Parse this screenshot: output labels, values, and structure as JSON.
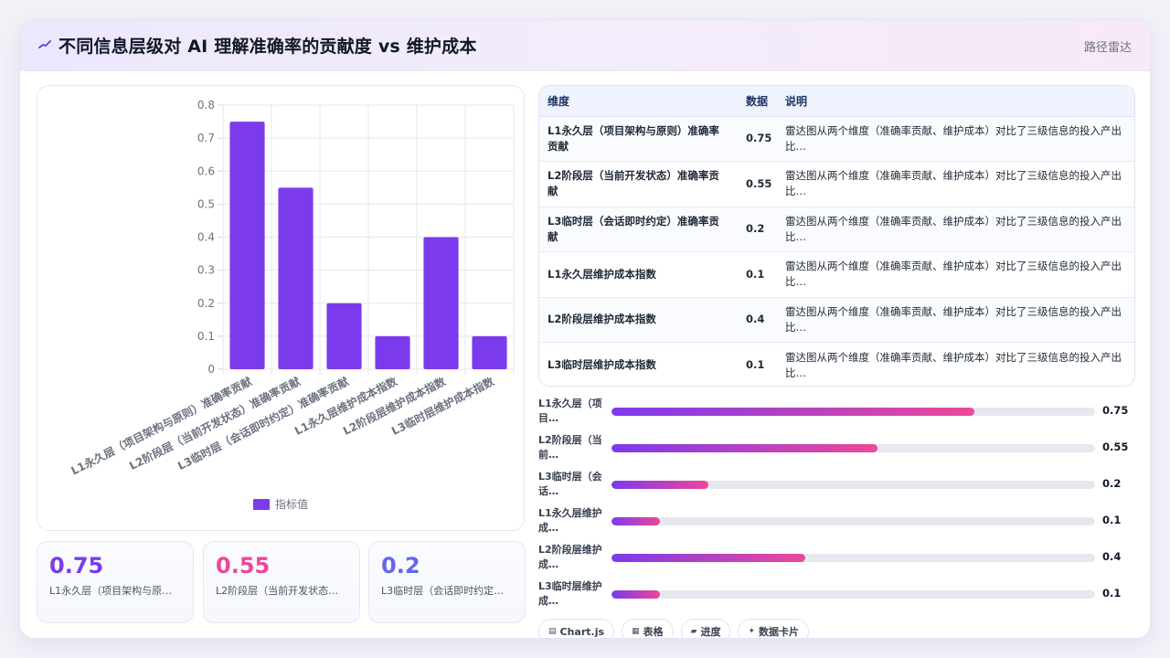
{
  "header": {
    "title": "不同信息层级对 AI 理解准确率的贡献度 vs 维护成本",
    "route": "路径雷达"
  },
  "chart_data": {
    "type": "bar",
    "categories": [
      "L1永久层（项目架构与原则）准确率贡献",
      "L2阶段层（当前开发状态）准确率贡献",
      "L3临时层（会话即时约定）准确率贡献",
      "L1永久层维护成本指数",
      "L2阶段层维护成本指数",
      "L3临时层维护成本指数"
    ],
    "series": [
      {
        "name": "指标值",
        "values": [
          0.75,
          0.55,
          0.2,
          0.1,
          0.4,
          0.1
        ],
        "color": "#7c3aed"
      }
    ],
    "ylim": [
      0,
      0.8
    ],
    "yticks": [
      0,
      0.1,
      0.2,
      0.3,
      0.4,
      0.5,
      0.6,
      0.7,
      0.8
    ],
    "grid": true,
    "legend": "bottom"
  },
  "stats": [
    {
      "value": "0.75",
      "label": "L1永久层（项目架构与原…",
      "color": "#7c3aed"
    },
    {
      "value": "0.55",
      "label": "L2阶段层（当前开发状态…",
      "color": "#ec4899"
    },
    {
      "value": "0.2",
      "label": "L3临时层（会话即时约定…",
      "color": "#6366f1"
    }
  ],
  "table": {
    "headers": [
      "维度",
      "数据",
      "说明"
    ],
    "rows": [
      {
        "dim": "L1永久层（项目架构与原则）准确率贡献",
        "val": "0.75",
        "desc": "雷达图从两个维度（准确率贡献、维护成本）对比了三级信息的投入产出比…"
      },
      {
        "dim": "L2阶段层（当前开发状态）准确率贡献",
        "val": "0.55",
        "desc": "雷达图从两个维度（准确率贡献、维护成本）对比了三级信息的投入产出比…"
      },
      {
        "dim": "L3临时层（会话即时约定）准确率贡献",
        "val": "0.2",
        "desc": "雷达图从两个维度（准确率贡献、维护成本）对比了三级信息的投入产出比…"
      },
      {
        "dim": "L1永久层维护成本指数",
        "val": "0.1",
        "desc": "雷达图从两个维度（准确率贡献、维护成本）对比了三级信息的投入产出比…"
      },
      {
        "dim": "L2阶段层维护成本指数",
        "val": "0.4",
        "desc": "雷达图从两个维度（准确率贡献、维护成本）对比了三级信息的投入产出比…"
      },
      {
        "dim": "L3临时层维护成本指数",
        "val": "0.1",
        "desc": "雷达图从两个维度（准确率贡献、维护成本）对比了三级信息的投入产出比…"
      }
    ]
  },
  "progress": [
    {
      "label": "L1永久层（项目…",
      "value": 0.75,
      "display": "0.75"
    },
    {
      "label": "L2阶段层（当前…",
      "value": 0.55,
      "display": "0.55"
    },
    {
      "label": "L3临时层（会话…",
      "value": 0.2,
      "display": "0.2"
    },
    {
      "label": "L1永久层维护成…",
      "value": 0.1,
      "display": "0.1"
    },
    {
      "label": "L2阶段层维护成…",
      "value": 0.4,
      "display": "0.4"
    },
    {
      "label": "L3临时层维护成…",
      "value": 0.1,
      "display": "0.1"
    }
  ],
  "tags": [
    {
      "icon": "chart-icon",
      "glyph": "▤",
      "label": "Chart.js"
    },
    {
      "icon": "table-icon",
      "glyph": "▦",
      "label": "表格"
    },
    {
      "icon": "progress-icon",
      "glyph": "▰",
      "label": "进度"
    },
    {
      "icon": "sparkle-icon",
      "glyph": "✦",
      "label": "数据卡片"
    }
  ]
}
